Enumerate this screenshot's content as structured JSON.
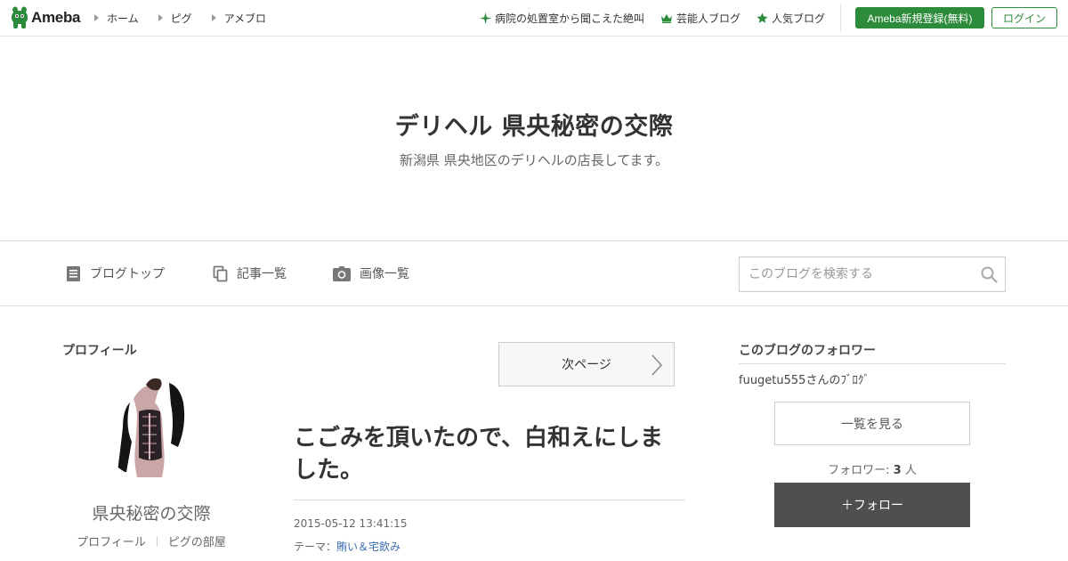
{
  "colors": {
    "brand_green": "#2d8c3c",
    "link_blue": "#3a6fb0",
    "follow_dark": "#4f4f4f"
  },
  "header": {
    "logo_text": "Ameba",
    "nav": [
      {
        "label": "ホーム",
        "icon": "triangle-right-icon"
      },
      {
        "label": "ピグ",
        "icon": "triangle-right-icon"
      },
      {
        "label": "アメブロ",
        "icon": "triangle-right-icon"
      }
    ],
    "links": [
      {
        "label": "病院の処置室から聞こえた絶叫",
        "icon": "sparkle-icon"
      },
      {
        "label": "芸能人ブログ",
        "icon": "crown-icon"
      },
      {
        "label": "人気ブログ",
        "icon": "star-icon"
      }
    ],
    "register_label": "Ameba新規登録(無料)",
    "login_label": "ログイン"
  },
  "blog": {
    "title": "デリヘル 県央秘密の交際",
    "description": "新潟県 県央地区のデリヘルの店長してます。"
  },
  "blognav": {
    "items": [
      {
        "label": "ブログトップ",
        "icon": "document-icon"
      },
      {
        "label": "記事一覧",
        "icon": "copy-icon"
      },
      {
        "label": "画像一覧",
        "icon": "camera-icon"
      }
    ],
    "search_placeholder": "このブログを検索する"
  },
  "profile": {
    "heading": "プロフィール",
    "name": "県央秘密の交際",
    "links": [
      "プロフィール",
      "ピグの部屋"
    ]
  },
  "main": {
    "next_page_label": "次ページ",
    "entry": {
      "title": "こごみを頂いたので、白和えにしました。",
      "date": "2015-05-12 13:41:15",
      "theme_label": "テーマ：",
      "theme": "賄い＆宅飲み"
    }
  },
  "followers": {
    "heading": "このブログのフォロワー",
    "items": [
      "fuugetu555さんのﾌﾞﾛｸﾞ"
    ],
    "list_button": "一覧を見る",
    "count_label": "フォロワー: ",
    "count": "3",
    "count_unit": " 人",
    "follow_button": "＋フォロー"
  }
}
